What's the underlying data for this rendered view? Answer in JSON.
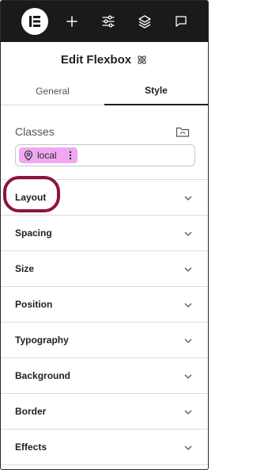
{
  "toolbar": {
    "logo": "elementor-logo-icon",
    "buttons": [
      "plus-icon",
      "sliders-icon",
      "layers-icon",
      "chat-icon"
    ]
  },
  "header": {
    "title": "Edit Flexbox",
    "icon": "atom-icon"
  },
  "tabs": [
    {
      "label": "General",
      "active": false
    },
    {
      "label": "Style",
      "active": true
    }
  ],
  "classes": {
    "label": "Classes",
    "chip": {
      "label": "local",
      "color": "#f0a9f0"
    }
  },
  "sections": [
    {
      "label": "Layout",
      "highlighted": true
    },
    {
      "label": "Spacing"
    },
    {
      "label": "Size"
    },
    {
      "label": "Position"
    },
    {
      "label": "Typography"
    },
    {
      "label": "Background"
    },
    {
      "label": "Border"
    },
    {
      "label": "Effects"
    }
  ],
  "colors": {
    "toolbar_bg": "#1a1a1a",
    "highlight": "#8c1538",
    "chip": "#f0a9f0"
  }
}
